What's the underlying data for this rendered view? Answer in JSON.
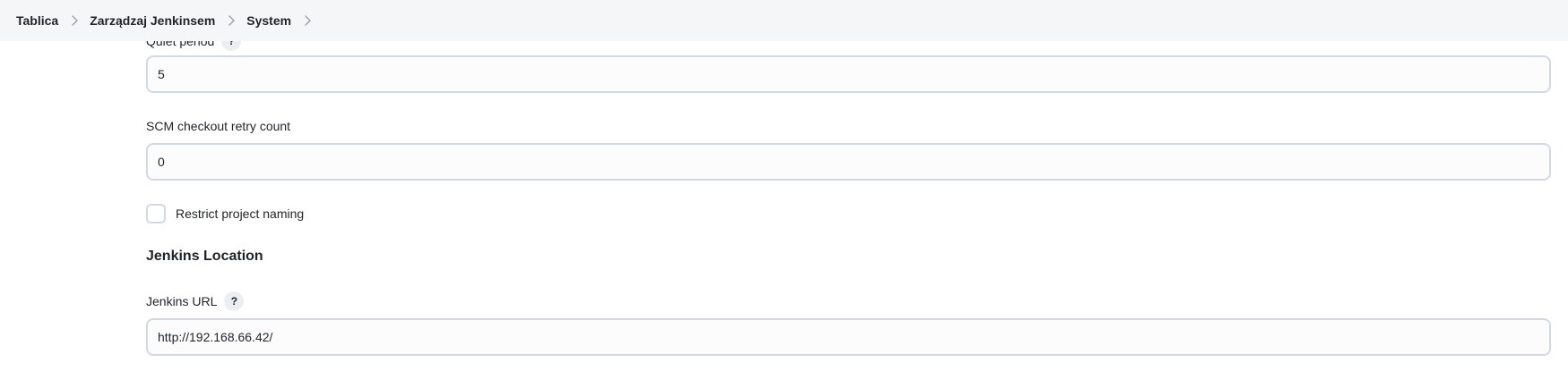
{
  "breadcrumb": {
    "items": [
      {
        "label": "Tablica"
      },
      {
        "label": "Zarządzaj Jenkinsem"
      },
      {
        "label": "System"
      }
    ]
  },
  "fields": {
    "quiet_period": {
      "label": "Quiet period",
      "help": "?",
      "value": "5"
    },
    "scm_retry": {
      "label": "SCM checkout retry count",
      "value": "0"
    },
    "restrict_naming": {
      "label": "Restrict project naming",
      "checked": false
    }
  },
  "jenkins_location": {
    "title": "Jenkins Location",
    "url_label": "Jenkins URL",
    "url_help": "?",
    "url_value": "http://192.168.66.42/"
  },
  "icons": {
    "separator": "chevron-right-icon",
    "help": "help-icon"
  },
  "colors": {
    "header_bg": "#f5f6f8",
    "input_border": "#d4d8e2",
    "help_bg": "#eceef1"
  }
}
